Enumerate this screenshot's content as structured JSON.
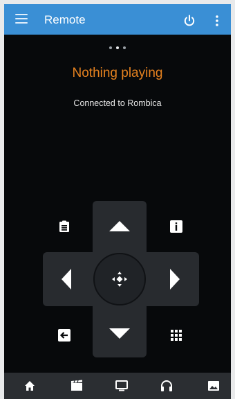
{
  "app_bar": {
    "title": "Remote",
    "icons": [
      "menu-icon",
      "power-icon",
      "more-vert-icon"
    ]
  },
  "pager": {
    "pages": 3,
    "active_index": 1
  },
  "status": {
    "now_playing": "Nothing playing",
    "connection": "Connected to Rombica"
  },
  "remote": {
    "buttons": [
      "context-menu",
      "up",
      "info",
      "left",
      "select",
      "right",
      "back",
      "down",
      "numpad"
    ]
  },
  "bottom_nav": {
    "items": [
      "home",
      "movies",
      "tv",
      "music",
      "pictures"
    ]
  },
  "colors": {
    "app_bar": "#3a8fd5",
    "background": "#07090b",
    "accent": "#e6821f",
    "pad": "#282b2f",
    "bottom_bar": "#2b2e32"
  }
}
